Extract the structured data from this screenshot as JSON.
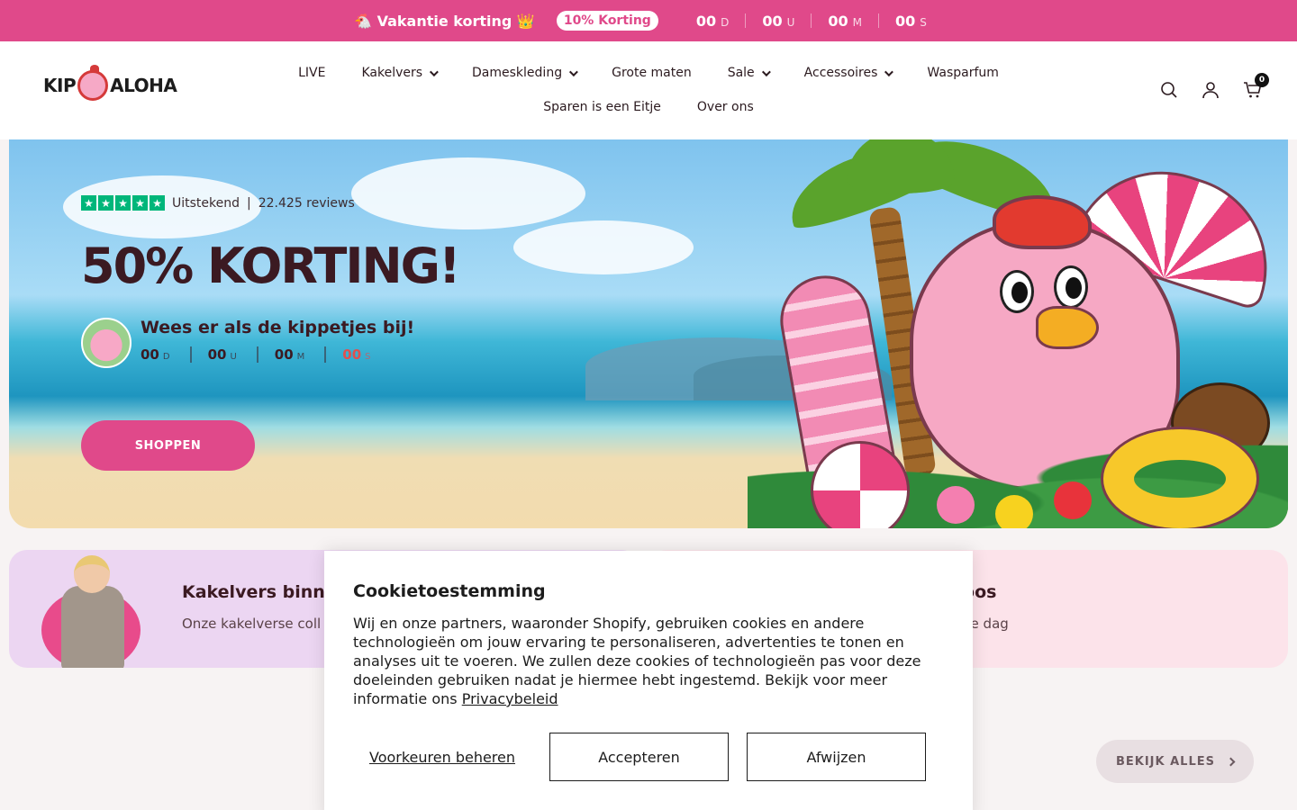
{
  "announcement": {
    "promo_text": "🐔 Vakantie korting 👑",
    "pill": "10% Korting",
    "countdown": [
      {
        "value": "00",
        "unit": "D"
      },
      {
        "value": "00",
        "unit": "U"
      },
      {
        "value": "00",
        "unit": "M"
      },
      {
        "value": "00",
        "unit": "S"
      }
    ]
  },
  "header": {
    "logo_left": "KIP",
    "logo_right": "ALOHA",
    "nav_row1": [
      "LIVE",
      "Kakelvers",
      "Dameskleding",
      "Grote maten",
      "Sale",
      "Accessoires",
      "Wasparfum"
    ],
    "nav_row2": [
      "Sparen is een Eitje",
      "Over ons"
    ],
    "cart_count": "0",
    "icons": [
      "search-icon",
      "account-icon",
      "cart-icon"
    ]
  },
  "hero": {
    "rating_label": "Uitstekend",
    "rating_sep": "|",
    "reviews": "22.425 reviews",
    "title": "50% KORTING!",
    "subtitle": "Wees er als de kippetjes bij!",
    "countdown": [
      {
        "value": "00",
        "unit": "D"
      },
      {
        "value": "00",
        "unit": "U"
      },
      {
        "value": "00",
        "unit": "M"
      },
      {
        "value": "00",
        "unit": "S"
      }
    ],
    "button": "SHOPPEN"
  },
  "categories": {
    "left": {
      "title": "Kakelvers binne",
      "text": "Onze kakelverse coll"
    },
    "right": {
      "title": "lloos",
      "text": "elke dag"
    }
  },
  "view_all": "BEKIJK ALLES",
  "cookie": {
    "title": "Cookietoestemming",
    "body": "Wij en onze partners, waaronder Shopify, gebruiken cookies en andere technologieën om jouw ervaring te personaliseren, advertenties te tonen en analyses uit te voeren. We zullen deze cookies of technologieën pas voor deze doeleinden gebruiken nadat je hiermee hebt ingestemd. Bekijk voor meer informatie ons ",
    "link": "Privacybeleid",
    "manage": "Voorkeuren beheren",
    "accept": "Accepteren",
    "decline": "Afwijzen"
  },
  "colors": {
    "brand_pink": "#e0498a",
    "trustpilot_green": "#00b67a",
    "title_dark": "#3b1a22"
  }
}
